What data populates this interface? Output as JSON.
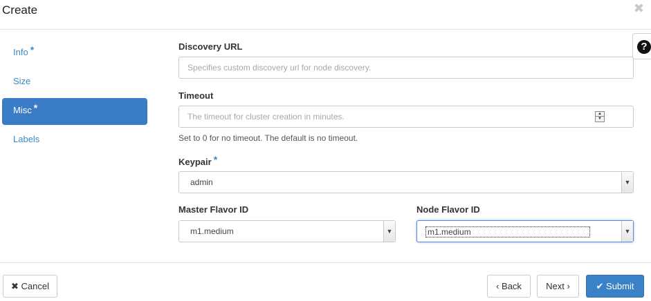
{
  "header": {
    "title": "Create",
    "close_icon": "close-icon"
  },
  "sidebar": {
    "items": [
      {
        "label": "Info",
        "required": "*"
      },
      {
        "label": "Size",
        "required": ""
      },
      {
        "label": "Misc",
        "required": "*"
      },
      {
        "label": "Labels",
        "required": ""
      }
    ],
    "active": "Misc"
  },
  "help": {
    "glyph": "?"
  },
  "form": {
    "discovery_url": {
      "label": "Discovery URL",
      "placeholder": "Specifies custom discovery url for node discovery."
    },
    "timeout": {
      "label": "Timeout",
      "placeholder": "The timeout for cluster creation in minutes.",
      "hint": "Set to 0 for no timeout. The default is no timeout."
    },
    "keypair": {
      "label": "Keypair",
      "required": "*",
      "value": "admin"
    },
    "master_flavor": {
      "label": "Master Flavor ID",
      "value": "m1.medium"
    },
    "node_flavor": {
      "label": "Node Flavor ID",
      "value": "m1.medium"
    }
  },
  "footer": {
    "cancel": "Cancel",
    "back": "Back",
    "next": "Next",
    "submit": "Submit"
  },
  "colors": {
    "accent": "#3a7cc6",
    "link": "#3a8ac6",
    "primary_button": "#3a82c8"
  }
}
